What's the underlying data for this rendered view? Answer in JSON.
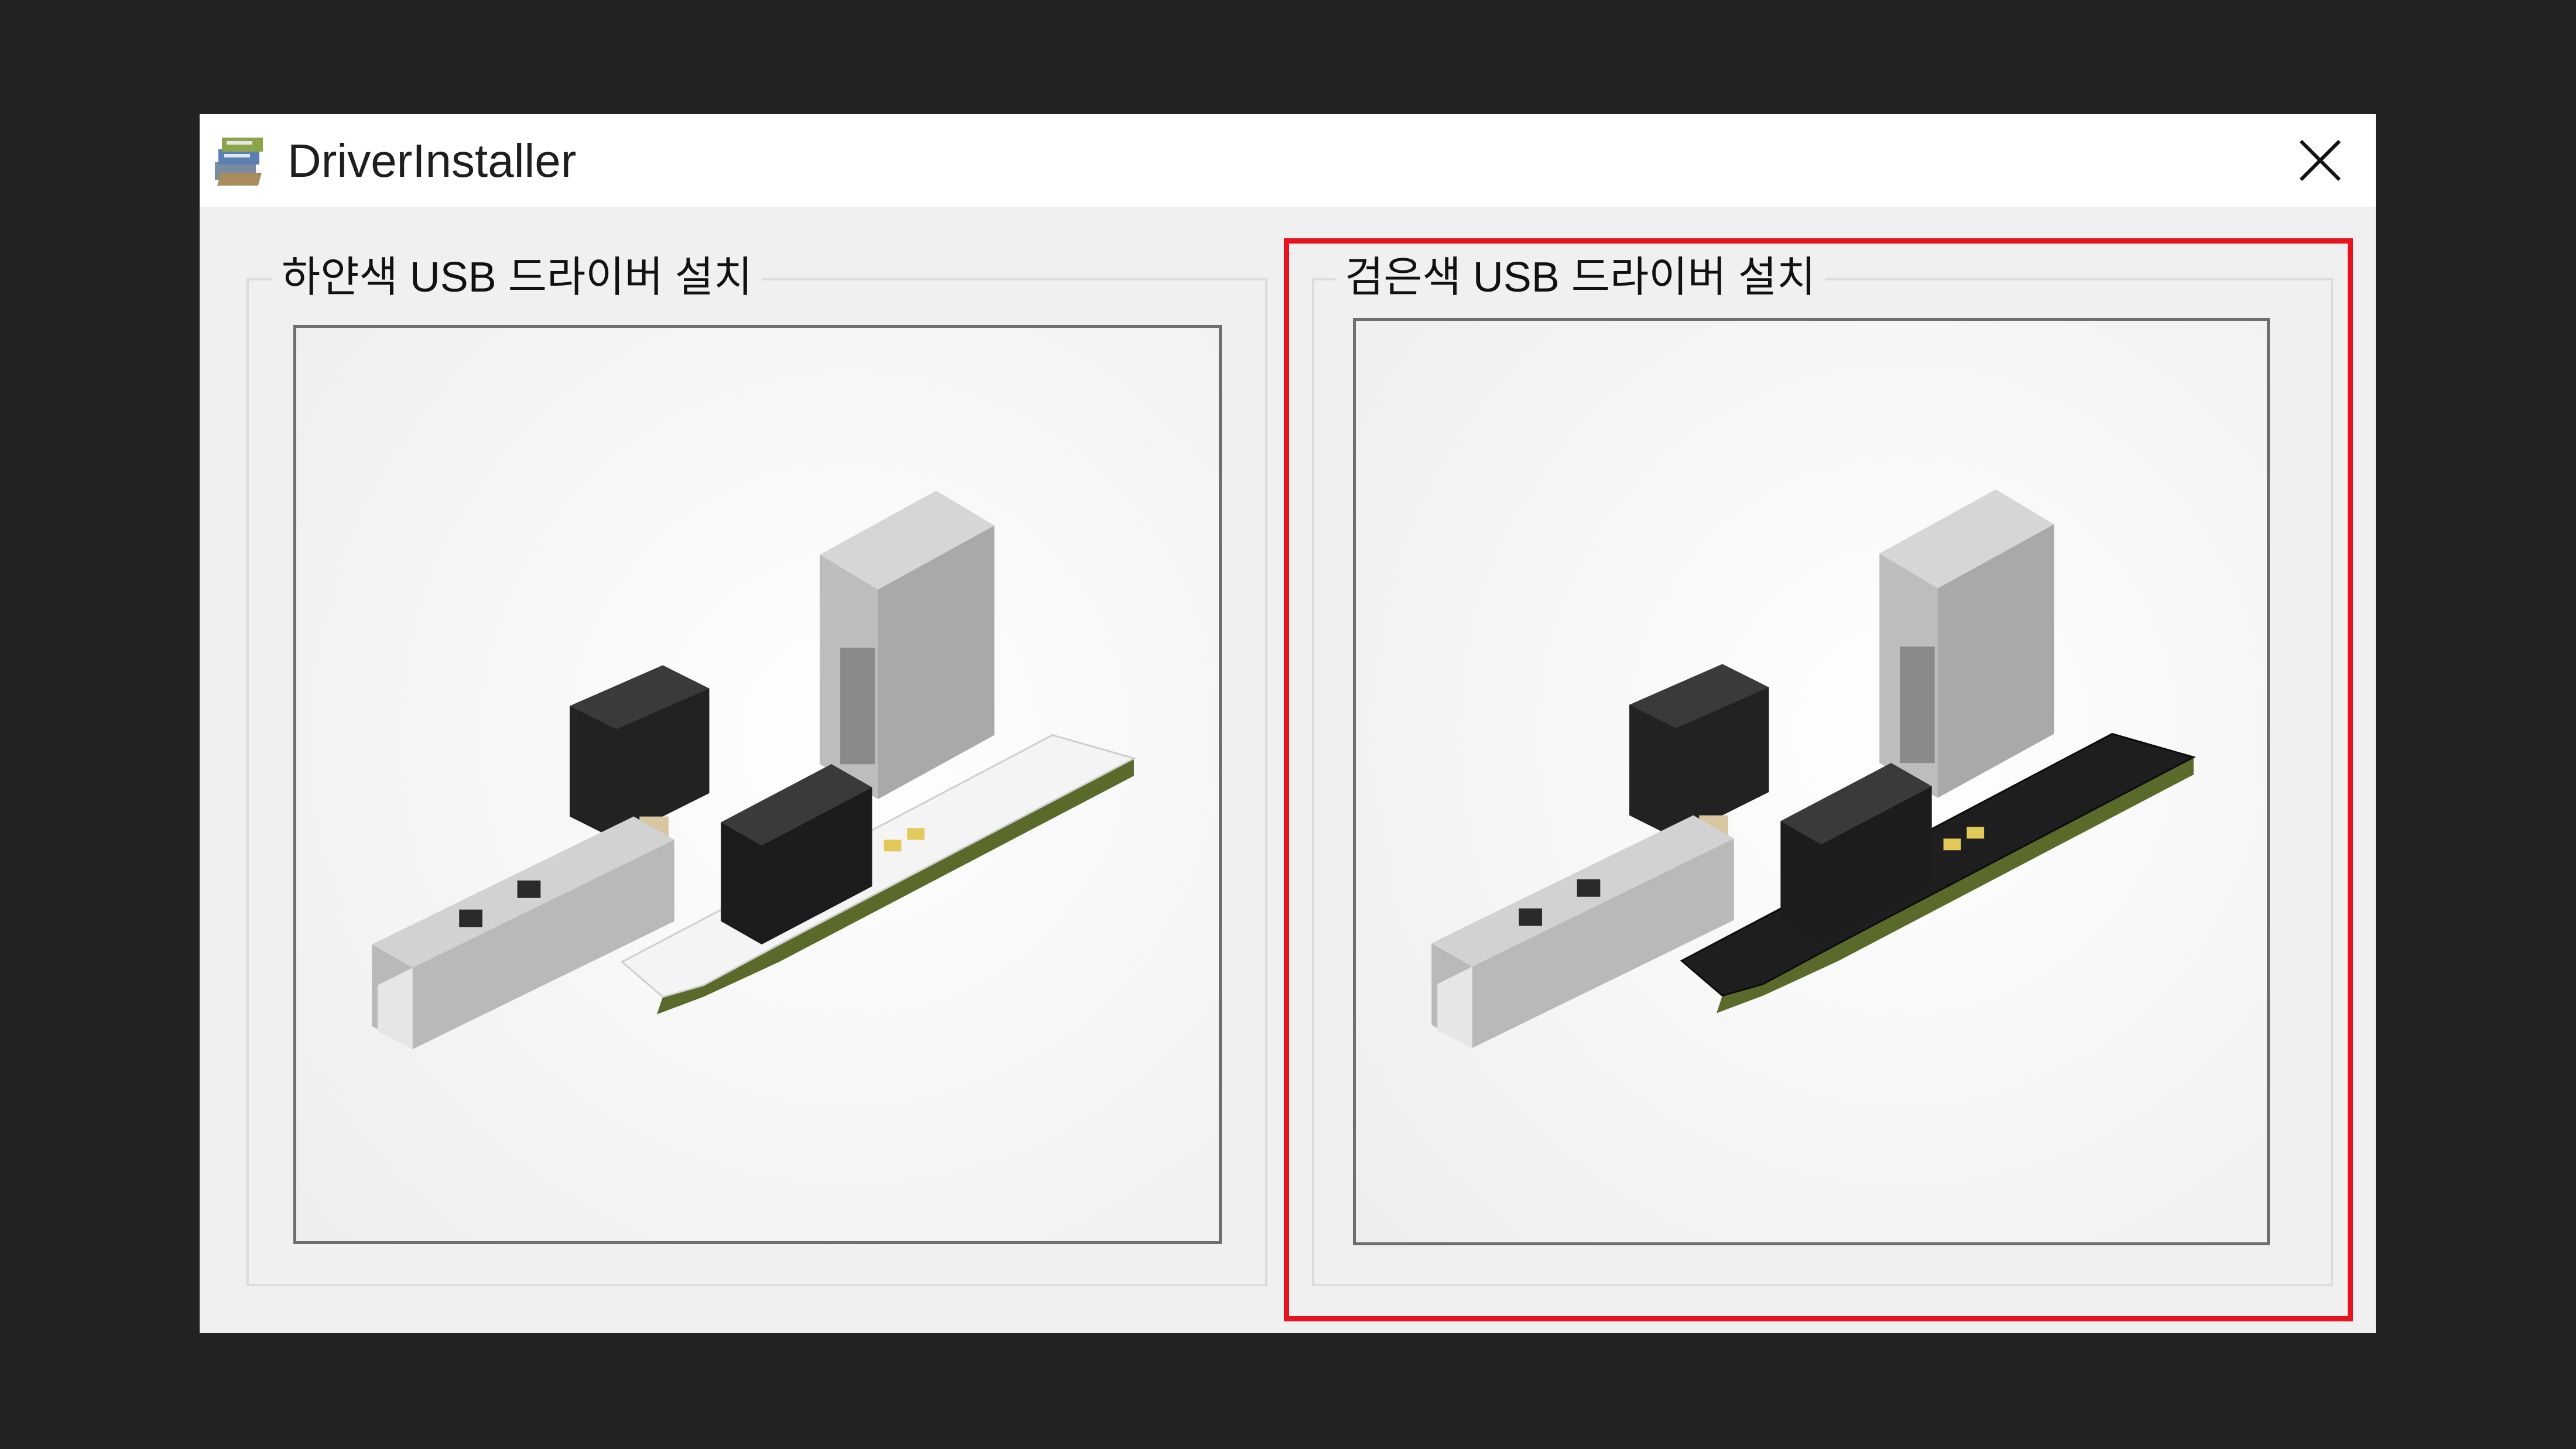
{
  "window": {
    "title": "DriverInstaller",
    "icon": "installer-icon",
    "close_icon": "close-icon"
  },
  "options": [
    {
      "label": "하얀색 USB 드라이버 설치",
      "board_color": "white",
      "image": "white-usb-board-image"
    },
    {
      "label": "검은색 USB 드라이버 설치",
      "board_color": "black",
      "image": "black-usb-board-image"
    }
  ],
  "highlight": {
    "target": "black-usb-option",
    "color": "#e8121f"
  }
}
